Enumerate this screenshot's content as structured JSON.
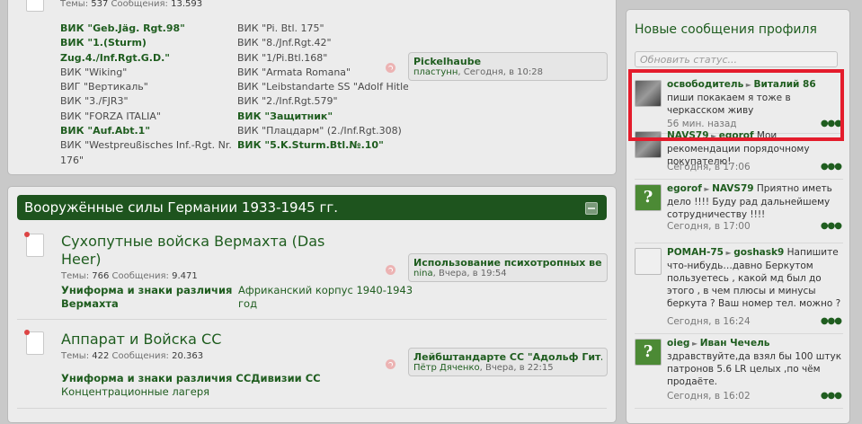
{
  "top_forum": {
    "stats_label_topics": "Темы:",
    "stats_topics": "537",
    "stats_label_messages": "Сообщения:",
    "stats_messages": "13.593",
    "subforums_col1": [
      {
        "text": "ВИК \"Geb.Jäg. Rgt.98\"",
        "bold": true
      },
      {
        "text": "ВИК \"1.(Sturm)",
        "bold": true
      },
      {
        "text": "Zug.4./Inf.Rgt.G.D.\"",
        "bold": true
      },
      {
        "text": "ВИК \"Wiking\"",
        "bold": false
      },
      {
        "text": "ВИГ \"Вертикаль\"",
        "bold": false
      },
      {
        "text": "ВИК \"3./FJR3\"",
        "bold": false
      },
      {
        "text": "ВИК \"FORZA ITALIA\"",
        "bold": false
      },
      {
        "text": "ВИК \"Auf.Abt.1\"",
        "bold": true
      },
      {
        "text": "ВИК \"Westpreußisches Inf.-Rgt. Nr.",
        "bold": false
      },
      {
        "text": "176\"",
        "bold": false
      }
    ],
    "subforums_col2": [
      {
        "text": "ВИК \"Pi. Btl. 175\"",
        "bold": false
      },
      {
        "text": "ВИК \"8./Jnf.Rgt.42\"",
        "bold": false
      },
      {
        "text": "ВИК \"1/Pi.Btl.168\"",
        "bold": false
      },
      {
        "text": "ВИК \"Armata Romana\"",
        "bold": false
      },
      {
        "text": "ВИК \"Leibstandarte SS \"Adolf Hitler\"",
        "bold": false
      },
      {
        "text": "ВИК \"2./Inf.Rgt.579\"",
        "bold": false
      },
      {
        "text": "ВИК \"Защитник\"",
        "bold": true
      },
      {
        "text": "ВИК \"Плацдарм\" (2./Inf.Rgt.308)",
        "bold": false
      },
      {
        "text": "ВИК \"5.K.Sturm.Btl.№.10\"",
        "bold": true
      }
    ],
    "last_post": {
      "title": "Pickelhaube",
      "user": "пластунн",
      "time": "Сегодня, в 10:28"
    }
  },
  "category": {
    "title": "Вооружённые силы Германии 1933-1945 гг.",
    "forums": [
      {
        "title_line1": "Сухопутные войска Вермахта (Das",
        "title_line2": "Heer)",
        "stats_label_topics": "Темы:",
        "topics": "766",
        "stats_label_messages": "Сообщения:",
        "messages": "9.471",
        "sub1_line1": "Униформа и знаки различия",
        "sub1_line2": "Вермахта",
        "sub2_line1": "Африканский корпус 1940-1943",
        "sub2_line2": "год",
        "last_title": "Использование психотропных ве...",
        "last_user": "nina",
        "last_time": "Вчера, в 19:54"
      },
      {
        "title_line1": "Аппарат и Войска СС",
        "stats_label_topics": "Темы:",
        "topics": "422",
        "stats_label_messages": "Сообщения:",
        "messages": "20.363",
        "sub1": "Униформа и знаки различия СС",
        "sub2": "Дивизии СС",
        "sub3": "Концентрационные лагеря",
        "last_title": "Лейбштандарте СС \"Адольф Гитл...",
        "last_user": "Пётр Дяченко",
        "last_time": "Вчера, в 22:15"
      }
    ]
  },
  "sidebar": {
    "title": "Новые сообщения профиля",
    "status_placeholder": "Обновить статус...",
    "messages": [
      {
        "from": "освободитель",
        "arrow": "►",
        "to": "Виталий 86",
        "text": " пиши покакаем я тоже в черкасском живу",
        "time": "56 мин. назад",
        "avatar": "photo"
      },
      {
        "from": "NAVS79",
        "arrow": "►",
        "to": "egorof",
        "text": " Мои рекомендации порядочному покупателю!",
        "time": "Сегодня, в 17:06",
        "avatar": "photo"
      },
      {
        "from": "egorof",
        "arrow": "►",
        "to": "NAVS79",
        "text": " Приятно иметь дело !!!! Буду рад дальнейшему сотрудничеству !!!!",
        "time": "Сегодня, в 17:00",
        "avatar": "question"
      },
      {
        "from": "РОМАН-75",
        "arrow": "►",
        "to": "goshask9",
        "text": " Напишите что-нибудь…давно Беркутом пользуетесь , какой мд был до этого , в чем плюсы и минусы беркута ? Ваш номер тел. можно ?",
        "time": "Сегодня, в 16:24",
        "avatar": "figure"
      },
      {
        "from": "oieg",
        "arrow": "►",
        "to": "Иван Чечель",
        "text": " здравствуйте,да взял бы 100 штук патронов 5.6 LR целых ,по чём продаёте.",
        "time": "Сегодня, в 16:02",
        "avatar": "question"
      }
    ],
    "more_glyph": "●●●",
    "question_glyph": "?"
  }
}
